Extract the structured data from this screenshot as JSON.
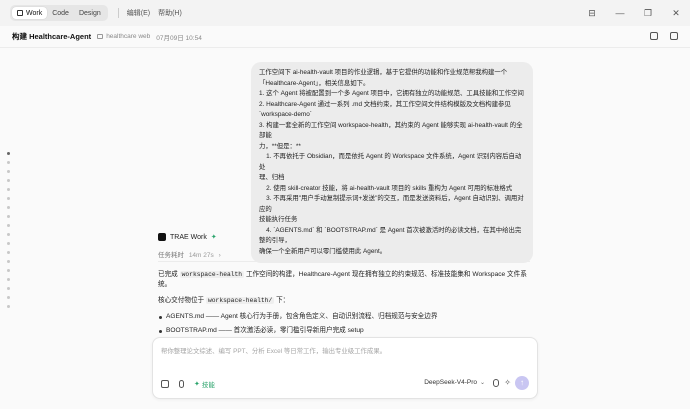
{
  "titlebar": {
    "modes": [
      "Work",
      "Code",
      "Design"
    ],
    "menus": [
      "编辑(E)",
      "帮助(H)"
    ],
    "controls": [
      "⊟",
      "—",
      "❐",
      "✕"
    ]
  },
  "header": {
    "title": "构建 Healthcare-Agent",
    "folder": "healthcare web",
    "date": "07月09日 10:54"
  },
  "user_message": {
    "lines": [
      "工作空间下 ai-health-vault 项目的作业逻辑，基于它提供的功能和作业规范帮我构建一个",
      "「Healthcare-Agent」，相关信息如下。",
      "1. 这个 Agent 将被配置到一个多 Agent 项目中，它拥有独立的功能规范、工具技能和工作空间",
      "2. Healthcare-Agent 通过一系列 .md 文档约束，其工作空间文件结构模版及文档构建参见",
      "`workspace-demo`",
      "3. 构建一套全新的工作空间 workspace-health，其约束的 Agent 能够实现 ai-health-vault 的全部能",
      "力，**但是：**",
      "    1. 不再依托于 Obsidian，而是依托 Agent 的 Workspace 文件系统，Agent 识别内容后自动处",
      "理、归档",
      "    2. 使用 skill-creator 技能，将 ai-health-vault 项目的 skills 重构为 Agent 可用的标准格式",
      "    3. 不再采用\"用户手动复制提示词+发送\"的交互，而是发送资料后，Agent 自动识别、调用对应的",
      "技能执行任务",
      "    4. `AGENTS.md` 和 `BOOTSTRAP.md` 是 Agent 首次被激活时的必读文档，在其中给出完整的引导，",
      "确保一个全新用户可以零门槛使用此 Agent。"
    ]
  },
  "agent": {
    "name": "TRAE Work",
    "elapsed_label": "任务耗时",
    "elapsed_value": "14m 27s"
  },
  "reply": {
    "intro_prefix": "已完成",
    "intro_code": "workspace-health",
    "intro_suffix": "工作空间的构建，Healthcare-Agent 现在拥有独立的约束规范、标准技能集和 Workspace 文件系统。",
    "core_prefix": "核心交付物位于",
    "core_code": "workspace-health/",
    "core_suffix": "下：",
    "items": [
      "AGENTS.md —— Agent 核心行为手册，包含角色定义、自动识别流程、归档规范与安全边界",
      "BOOTSTRAP.md —— 首次激活必读，零门槛引导新用户完成 setup"
    ]
  },
  "composer": {
    "placeholder": "帮你整理论文综述、编写 PPT、分析 Excel 等日常工作，输出专业级工作成果。",
    "skill_label": "技能",
    "model": "DeepSeek-V4-Pro"
  }
}
